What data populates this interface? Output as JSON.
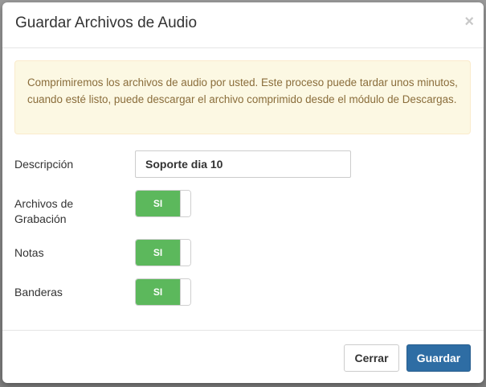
{
  "modal": {
    "title": "Guardar Archivos de Audio",
    "close_label": "×"
  },
  "alert": {
    "message": "Comprimiremos los archivos de audio por usted. Este proceso puede tardar unos minutos, cuando esté listo, puede descargar el archivo comprimido desde el módulo de Descargas."
  },
  "form": {
    "description": {
      "label": "Descripción",
      "value": "Soporte dia 10"
    },
    "recordings": {
      "label_line1": "Archivos de",
      "label_line2": "Grabación",
      "toggle_text": "SI",
      "state": "on"
    },
    "notes": {
      "label": "Notas",
      "toggle_text": "SI",
      "state": "on"
    },
    "flags": {
      "label": "Banderas",
      "toggle_text": "SI",
      "state": "on"
    }
  },
  "footer": {
    "close_label": "Cerrar",
    "save_label": "Guardar"
  },
  "colors": {
    "toggle_on": "#5cb85c",
    "primary": "#2e6da4",
    "alert_bg": "#fcf8e3",
    "alert_text": "#8a6d3b"
  }
}
